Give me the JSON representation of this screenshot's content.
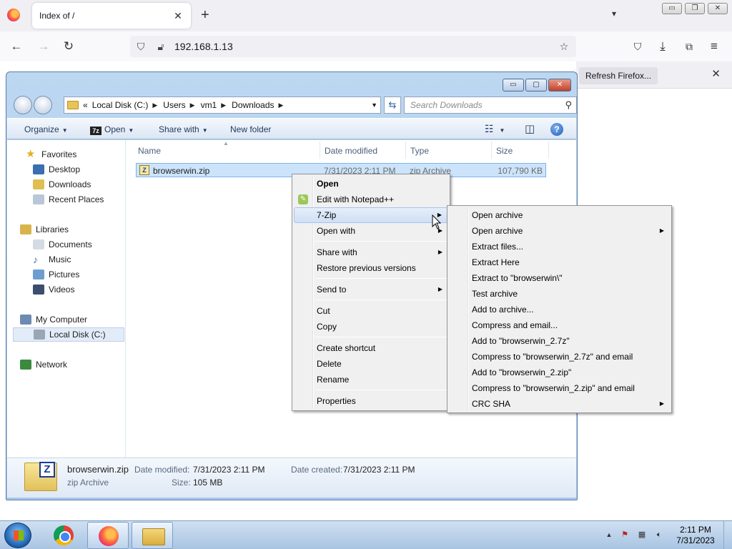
{
  "browser": {
    "tab_title": "Index of /",
    "tab_close": "✕",
    "new_tab": "+",
    "list_tabs": "▾",
    "url": "192.168.1.13",
    "refresh_firefox": "Refresh Firefox...",
    "notice_close": "✕",
    "win_min": "▭",
    "win_restore": "❐",
    "win_close": "✕"
  },
  "explorer": {
    "caption_min": "▭",
    "caption_max": "▢",
    "caption_close": "✕",
    "breadcrumb": [
      "«",
      "Local Disk (C:)",
      "Users",
      "vm1",
      "Downloads"
    ],
    "search_placeholder": "Search Downloads",
    "toolbar": {
      "organize": "Organize",
      "open": "Open",
      "share_with": "Share with",
      "new_folder": "New folder",
      "help": "?"
    },
    "nav": {
      "favorites": "Favorites",
      "desktop": "Desktop",
      "downloads": "Downloads",
      "recent_places": "Recent Places",
      "libraries": "Libraries",
      "documents": "Documents",
      "music": "Music",
      "pictures": "Pictures",
      "videos": "Videos",
      "my_computer": "My Computer",
      "local_disk": "Local Disk (C:)",
      "network": "Network"
    },
    "columns": {
      "name": "Name",
      "date_modified": "Date modified",
      "type": "Type",
      "size": "Size"
    },
    "file": {
      "name": "browserwin.zip",
      "date_modified": "7/31/2023 2:11 PM",
      "type": "zip Archive",
      "size": "107,790 KB"
    },
    "details": {
      "name": "browserwin.zip",
      "type": "zip Archive",
      "date_modified_label": "Date modified:",
      "date_modified": "7/31/2023 2:11 PM",
      "date_created_label": "Date created:",
      "date_created": "7/31/2023 2:11 PM",
      "size_label": "Size:",
      "size": "105 MB"
    }
  },
  "context_menu": {
    "open": "Open",
    "edit_notepad": "Edit with Notepad++",
    "seven_zip": "7-Zip",
    "open_with": "Open with",
    "share_with": "Share with",
    "restore_previous": "Restore previous versions",
    "send_to": "Send to",
    "cut": "Cut",
    "copy": "Copy",
    "create_shortcut": "Create shortcut",
    "delete": "Delete",
    "rename": "Rename",
    "properties": "Properties"
  },
  "submenu_7zip": {
    "items": [
      "Open archive",
      "Open archive",
      "Extract files...",
      "Extract Here",
      "Extract to \"browserwin\\\"",
      "Test archive",
      "Add to archive...",
      "Compress and email...",
      "Add to \"browserwin_2.7z\"",
      "Compress to \"browserwin_2.7z\" and email",
      "Add to \"browserwin_2.zip\"",
      "Compress to \"browserwin_2.zip\" and email",
      "CRC SHA"
    ]
  },
  "taskbar": {
    "time": "2:11 PM",
    "date": "7/31/2023"
  },
  "icons": {
    "submenu_arrow": "▶",
    "dropdown_arrow": "▼"
  }
}
